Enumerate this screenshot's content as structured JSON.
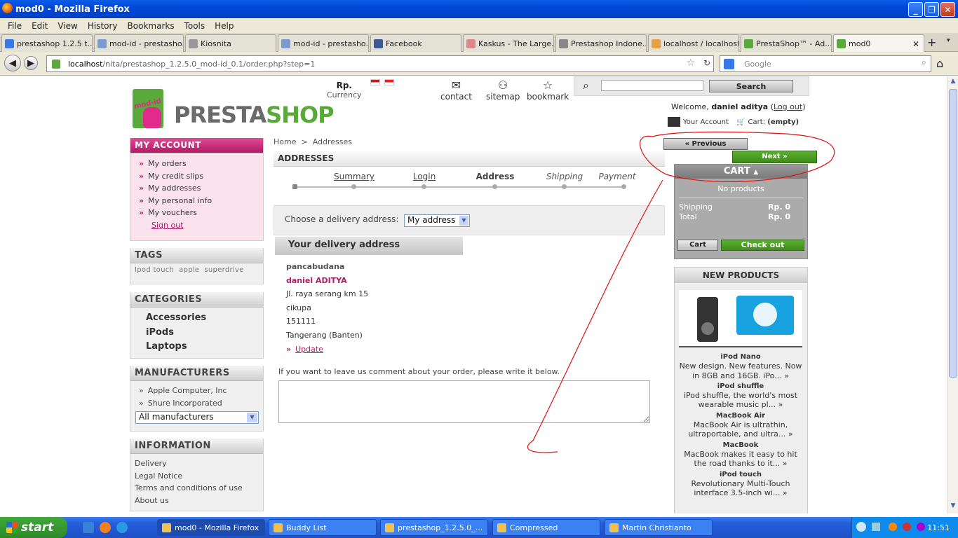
{
  "window": {
    "title": "mod0 - Mozilla Firefox"
  },
  "menu": [
    "File",
    "Edit",
    "View",
    "History",
    "Bookmarks",
    "Tools",
    "Help"
  ],
  "tabs": [
    {
      "label": "prestashop 1.2.5 t..."
    },
    {
      "label": "mod-id - prestasho..."
    },
    {
      "label": "Kiosnita"
    },
    {
      "label": "mod-id - prestasho..."
    },
    {
      "label": "Facebook"
    },
    {
      "label": "Kaskus - The Large..."
    },
    {
      "label": "Prestashop Indone..."
    },
    {
      "label": "localhost / localhost..."
    },
    {
      "label": "PrestaShop™ - Ad..."
    },
    {
      "label": "mod0"
    }
  ],
  "url": {
    "host": "localhost",
    "path": "/nita/prestashop_1.2.5.0_mod-id_0.1/order.php?step=1"
  },
  "search_placeholder": "Google",
  "header": {
    "logo_bag_text": "mod-id",
    "logo_presta": "PRESTA",
    "logo_shop": "SHOP",
    "currency_symbol": "Rp.",
    "currency_label": "Currency",
    "links": {
      "contact": "contact",
      "sitemap": "sitemap",
      "bookmark": "bookmark"
    },
    "search_button": "Search",
    "welcome_prefix": "Welcome,",
    "user_name": "daniel aditya",
    "logout": "Log out",
    "your_account": "Your Account",
    "cart_label": "Cart:",
    "cart_status": "(empty)"
  },
  "my_account": {
    "title": "MY ACCOUNT",
    "items": [
      "My orders",
      "My credit slips",
      "My addresses",
      "My personal info",
      "My vouchers"
    ],
    "sign_out": "Sign out"
  },
  "tags": {
    "title": "TAGS",
    "items": [
      "Ipod touch",
      "apple",
      "superdrive"
    ]
  },
  "categories": {
    "title": "CATEGORIES",
    "items": [
      "Accessories",
      "iPods",
      "Laptops"
    ]
  },
  "manufacturers": {
    "title": "MANUFACTURERS",
    "items": [
      "Apple Computer, Inc",
      "Shure Incorporated"
    ],
    "select": "All manufacturers"
  },
  "information": {
    "title": "INFORMATION",
    "items": [
      "Delivery",
      "Legal Notice",
      "Terms and conditions of use",
      "About us"
    ]
  },
  "breadcrumb": {
    "home": "Home",
    "sep": ">",
    "current": "Addresses"
  },
  "main": {
    "title": "ADDRESSES",
    "steps": [
      "Summary",
      "Login",
      "Address",
      "Shipping",
      "Payment"
    ],
    "choose_label": "Choose a delivery address:",
    "choose_value": "My address",
    "delivery_title": "Your delivery address",
    "address": {
      "company": "pancabudana",
      "name": "daniel ADITYA",
      "street": "Jl. raya serang km 15",
      "city": "cikupa",
      "postcode": "151111",
      "region": "Tangerang (Banten)",
      "update": "Update"
    },
    "comment_label": "If you want to leave us comment about your order, please write it below."
  },
  "nav_buttons": {
    "previous": "« Previous",
    "next": "Next »"
  },
  "cart": {
    "title": "CART",
    "empty": "No products",
    "shipping_label": "Shipping",
    "shipping_value": "Rp. 0",
    "total_label": "Total",
    "total_value": "Rp. 0",
    "cart_button": "Cart",
    "checkout_button": "Check out"
  },
  "new_products": {
    "title": "NEW PRODUCTS",
    "items": [
      {
        "name": "iPod Nano",
        "desc": "New design. New features. Now in 8GB and 16GB. iPo... »"
      },
      {
        "name": "iPod shuffle",
        "desc": "iPod shuffle, the world's most wearable music pl... »"
      },
      {
        "name": "MacBook Air",
        "desc": "MacBook Air is ultrathin, ultraportable, and ultra... »"
      },
      {
        "name": "MacBook",
        "desc": "MacBook makes it easy to hit the road thanks to it... »"
      },
      {
        "name": "iPod touch",
        "desc": "Revolutionary Multi-Touch interface 3.5-inch wi... »"
      }
    ]
  },
  "taskbar": {
    "start": "start",
    "tasks": [
      "mod0 - Mozilla Firefox",
      "Buddy List",
      "prestashop_1.2.5.0_...",
      "Compressed",
      "Martin Christianto"
    ],
    "clock": "11:51"
  },
  "colors": {
    "accent_pink": "#b01a66",
    "accent_green": "#5aa93b",
    "xp_blue": "#245ddb",
    "annotation_red": "#e01010"
  }
}
